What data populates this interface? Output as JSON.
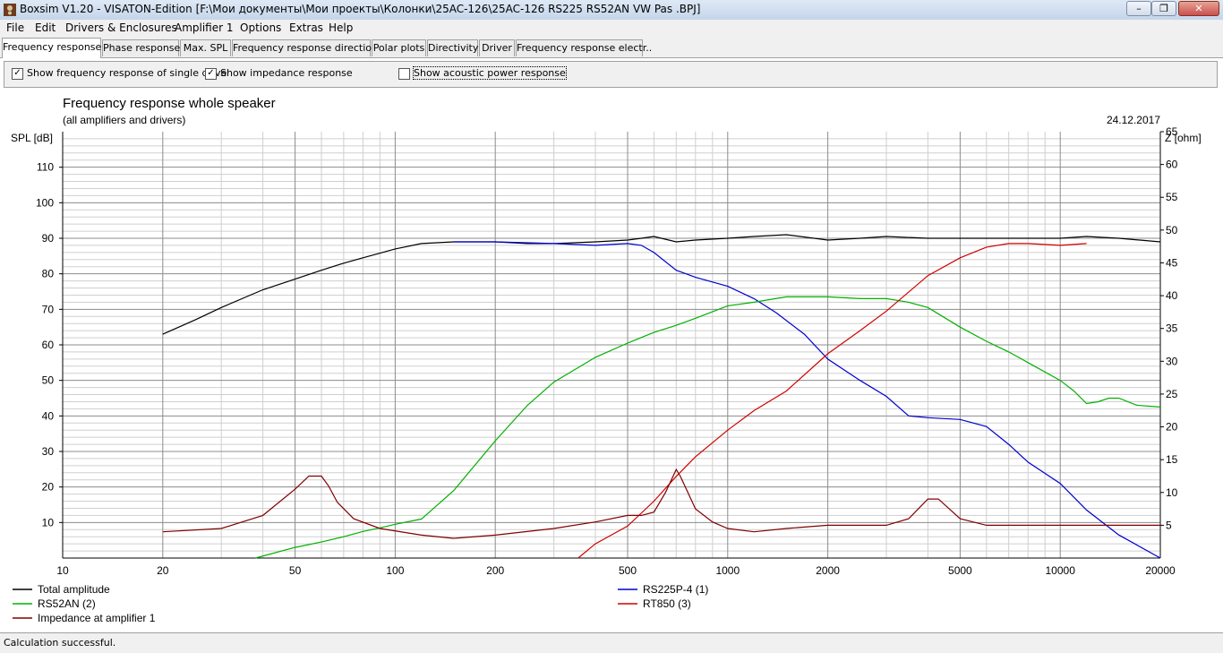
{
  "window": {
    "title": "Boxsim V1.20 - VISATON-Edition [F:\\Мои документы\\Мои проекты\\Колонки\\25AC-126\\25AC-126 RS225 RS52AN VW Pas .BPJ]",
    "icon": "boxsim-app-icon",
    "controls": {
      "minimize": "–",
      "maximize": "❐",
      "close": "✕"
    }
  },
  "menu": [
    "File",
    "Edit",
    "Drivers & Enclosures",
    "Amplifier 1",
    "Options",
    "Extras",
    "Help"
  ],
  "tabs": [
    {
      "label": "Frequency response.",
      "active": true
    },
    {
      "label": "Phase response"
    },
    {
      "label": "Max. SPL"
    },
    {
      "label": "Frequency response directions"
    },
    {
      "label": "Polar plots"
    },
    {
      "label": "Directivity"
    },
    {
      "label": "Driver"
    },
    {
      "label": "Frequency response electr.."
    }
  ],
  "options": {
    "single_drive": {
      "label": "Show frequency response of single drive",
      "checked": true
    },
    "impedance": {
      "label": "Show impedance response",
      "checked": true
    },
    "acoustic_power": {
      "label": "Show acoustic power response",
      "checked": false
    }
  },
  "status": "Calculation successful.",
  "chart_data": {
    "type": "line",
    "title": "Frequency response whole speaker",
    "subtitle": "(all amplifiers and drivers)",
    "date": "24.12.2017",
    "ylabel": "SPL [dB]",
    "y2label": "Z [ohm]",
    "x_scale": "log",
    "xlim": [
      10,
      20000
    ],
    "ylim": [
      0,
      120
    ],
    "y2lim": [
      0,
      65
    ],
    "grid": true,
    "x_ticks": [
      10,
      20,
      50,
      100,
      200,
      500,
      1000,
      2000,
      5000,
      10000,
      20000
    ],
    "y_ticks": [
      10,
      20,
      30,
      40,
      50,
      60,
      70,
      80,
      90,
      100,
      110
    ],
    "y2_ticks": [
      5,
      10,
      15,
      20,
      25,
      30,
      35,
      40,
      45,
      50,
      55,
      60,
      65
    ],
    "legend_position": "bottom",
    "series": [
      {
        "name": "Total amplitude",
        "color": "#000000",
        "axis": "left",
        "x": [
          20,
          25,
          30,
          40,
          50,
          60,
          70,
          80,
          100,
          120,
          150,
          200,
          250,
          300,
          400,
          500,
          550,
          600,
          700,
          800,
          1000,
          1200,
          1500,
          2000,
          2500,
          3000,
          4000,
          5000,
          7000,
          10000,
          12000,
          15000,
          20000
        ],
        "y": [
          63,
          67,
          70.5,
          75.5,
          78.5,
          81,
          83,
          84.5,
          87,
          88.5,
          89,
          89,
          88.5,
          88.5,
          89,
          89.5,
          90,
          90.5,
          89,
          89.5,
          90,
          90.5,
          91,
          89.5,
          90,
          90.5,
          90,
          90,
          90,
          90,
          90.5,
          90,
          89
        ]
      },
      {
        "name": "RS225P-4 (1)",
        "color": "#0000d0",
        "axis": "left",
        "x": [
          150,
          200,
          300,
          400,
          500,
          550,
          600,
          700,
          800,
          1000,
          1200,
          1400,
          1700,
          2000,
          2500,
          3000,
          3500,
          4000,
          5000,
          6000,
          7000,
          8000,
          10000,
          12000,
          15000,
          20000
        ],
        "y": [
          89,
          89,
          88.5,
          88,
          88.5,
          88,
          86,
          81,
          79,
          76.5,
          73,
          69,
          63,
          56,
          50,
          45.5,
          40,
          39.5,
          39,
          37,
          32,
          27,
          21,
          13.5,
          6.5,
          0
        ]
      },
      {
        "name": "RS52AN (2)",
        "color": "#00b000",
        "axis": "left",
        "x": [
          38,
          50,
          60,
          70,
          80,
          90,
          100,
          120,
          150,
          200,
          250,
          300,
          400,
          500,
          600,
          700,
          800,
          1000,
          1200,
          1500,
          2000,
          2500,
          3000,
          3500,
          4000,
          5000,
          6000,
          7000,
          8000,
          10000,
          11000,
          12000,
          13000,
          14000,
          15000,
          17000,
          20000
        ],
        "y": [
          0,
          3,
          4.5,
          6,
          7.5,
          8.5,
          9.5,
          11,
          19,
          33,
          43,
          49.5,
          56.5,
          60.5,
          63.5,
          65.5,
          67.5,
          71,
          72,
          73.5,
          73.5,
          73,
          73,
          72,
          70.5,
          65,
          61,
          58,
          55,
          50,
          47,
          43.5,
          44,
          45,
          45,
          43,
          42.5
        ]
      },
      {
        "name": "RT850 (3)",
        "color": "#d00000",
        "axis": "left",
        "x": [
          355,
          400,
          500,
          600,
          700,
          800,
          1000,
          1200,
          1500,
          2000,
          2500,
          3000,
          4000,
          5000,
          6000,
          7000,
          8000,
          10000,
          12000
        ],
        "y": [
          0,
          4,
          9,
          16,
          23,
          28.5,
          36,
          41.5,
          47,
          57.5,
          64,
          69.5,
          79.5,
          84.5,
          87.5,
          88.5,
          88.5,
          88,
          88.5
        ]
      },
      {
        "name": "Impedance at amplifier 1",
        "color": "#800000",
        "axis": "right",
        "x": [
          20,
          30,
          40,
          50,
          55,
          60,
          63,
          67,
          75,
          90,
          120,
          150,
          200,
          300,
          400,
          500,
          550,
          600,
          650,
          700,
          720,
          800,
          900,
          1000,
          1200,
          1500,
          2000,
          2500,
          3000,
          3500,
          4000,
          4300,
          5000,
          6000,
          8000,
          10000,
          20000
        ],
        "y": [
          4,
          4.5,
          6.5,
          10.5,
          12.5,
          12.5,
          11,
          8.5,
          6,
          4.5,
          3.5,
          3,
          3.5,
          4.5,
          5.5,
          6.5,
          6.5,
          7,
          10,
          13.5,
          12.5,
          7.5,
          5.5,
          4.5,
          4,
          4.5,
          5,
          5,
          5,
          6,
          9,
          9,
          6,
          5,
          5,
          5,
          5
        ]
      }
    ]
  }
}
